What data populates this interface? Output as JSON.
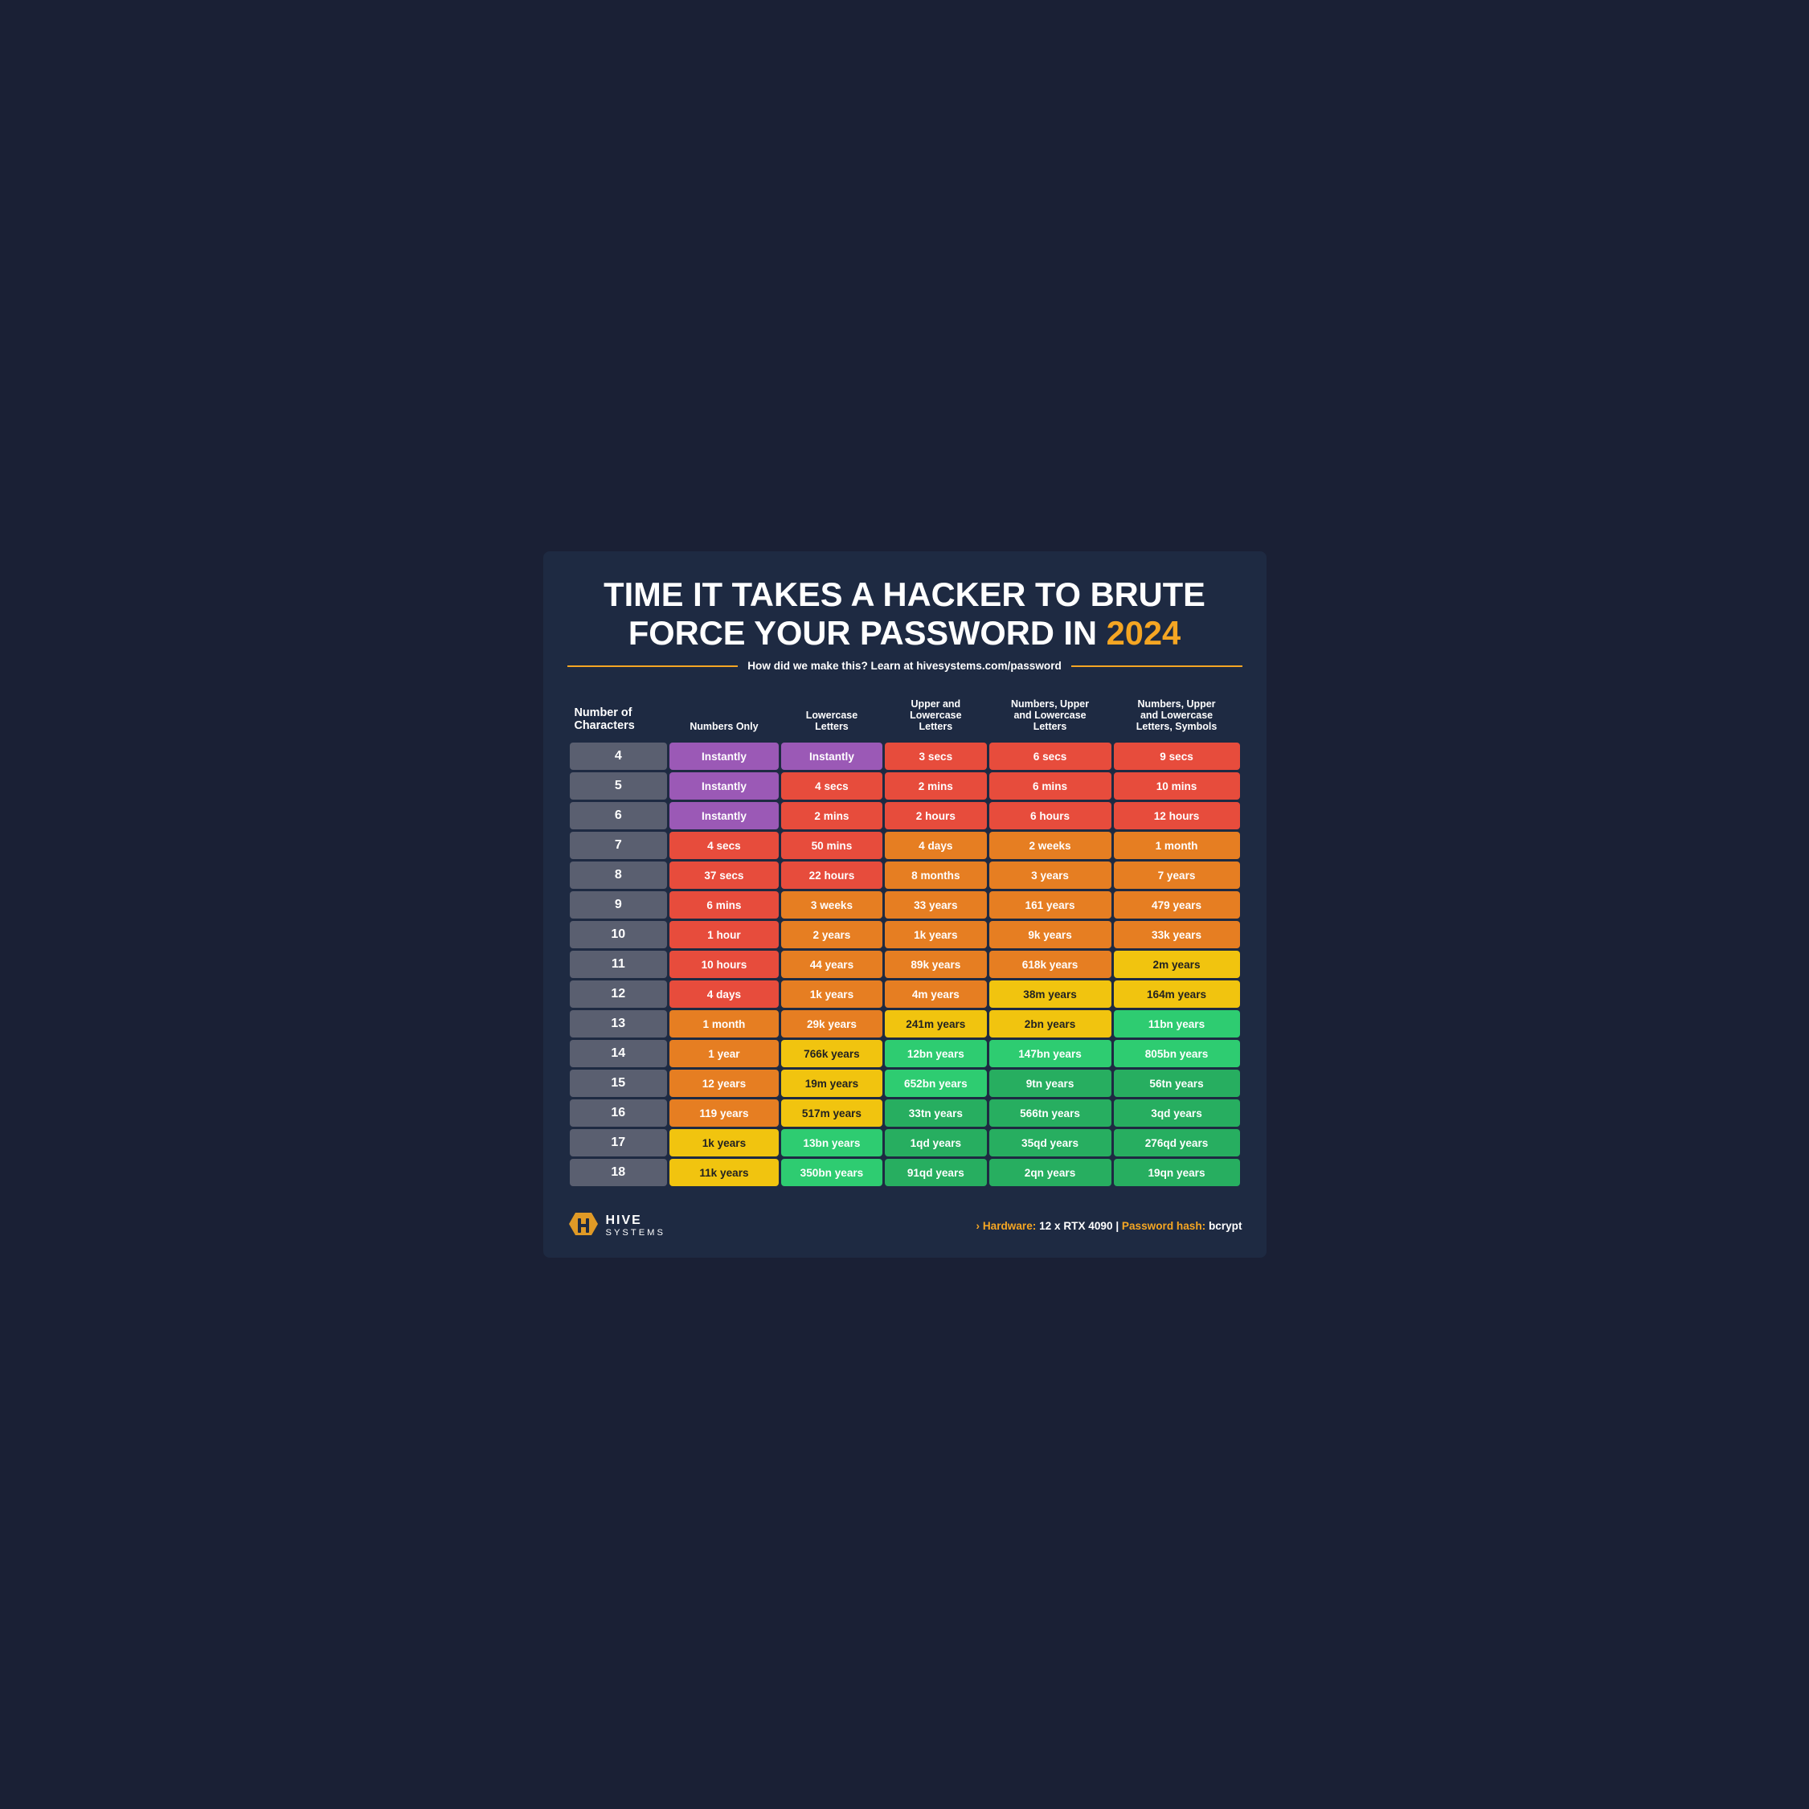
{
  "header": {
    "title_line1": "TIME IT TAKES A HACKER TO BRUTE",
    "title_line2": "FORCE YOUR PASSWORD IN",
    "year": "2024",
    "subtitle": "How did we make this? Learn at hivesystems.com/password"
  },
  "columns": [
    "Number of Characters",
    "Numbers Only",
    "Lowercase Letters",
    "Upper and Lowercase Letters",
    "Numbers, Upper and Lowercase Letters",
    "Numbers, Upper and Lowercase Letters, Symbols"
  ],
  "rows": [
    {
      "chars": "4",
      "c1": "Instantly",
      "c2": "Instantly",
      "c3": "3 secs",
      "c4": "6 secs",
      "c5": "9 secs",
      "cls": [
        "instantly",
        "instantly",
        "red",
        "red",
        "red"
      ]
    },
    {
      "chars": "5",
      "c1": "Instantly",
      "c2": "4 secs",
      "c3": "2 mins",
      "c4": "6 mins",
      "c5": "10 mins",
      "cls": [
        "instantly",
        "red",
        "red",
        "red",
        "red"
      ]
    },
    {
      "chars": "6",
      "c1": "Instantly",
      "c2": "2 mins",
      "c3": "2 hours",
      "c4": "6 hours",
      "c5": "12 hours",
      "cls": [
        "instantly",
        "red",
        "red",
        "red",
        "red"
      ]
    },
    {
      "chars": "7",
      "c1": "4 secs",
      "c2": "50 mins",
      "c3": "4 days",
      "c4": "2 weeks",
      "c5": "1 month",
      "cls": [
        "red",
        "red",
        "orange",
        "orange",
        "orange"
      ]
    },
    {
      "chars": "8",
      "c1": "37 secs",
      "c2": "22 hours",
      "c3": "8 months",
      "c4": "3 years",
      "c5": "7 years",
      "cls": [
        "red",
        "red",
        "orange",
        "orange",
        "orange"
      ]
    },
    {
      "chars": "9",
      "c1": "6 mins",
      "c2": "3 weeks",
      "c3": "33 years",
      "c4": "161 years",
      "c5": "479 years",
      "cls": [
        "red",
        "orange",
        "orange",
        "orange",
        "orange"
      ]
    },
    {
      "chars": "10",
      "c1": "1 hour",
      "c2": "2 years",
      "c3": "1k years",
      "c4": "9k years",
      "c5": "33k years",
      "cls": [
        "red",
        "orange",
        "orange",
        "orange",
        "orange"
      ]
    },
    {
      "chars": "11",
      "c1": "10 hours",
      "c2": "44 years",
      "c3": "89k years",
      "c4": "618k years",
      "c5": "2m years",
      "cls": [
        "red",
        "orange",
        "orange",
        "orange",
        "yellow"
      ]
    },
    {
      "chars": "12",
      "c1": "4 days",
      "c2": "1k years",
      "c3": "4m years",
      "c4": "38m years",
      "c5": "164m years",
      "cls": [
        "red",
        "orange",
        "orange",
        "yellow",
        "yellow"
      ]
    },
    {
      "chars": "13",
      "c1": "1 month",
      "c2": "29k years",
      "c3": "241m years",
      "c4": "2bn years",
      "c5": "11bn years",
      "cls": [
        "orange",
        "orange",
        "yellow",
        "yellow",
        "light-green"
      ]
    },
    {
      "chars": "14",
      "c1": "1 year",
      "c2": "766k years",
      "c3": "12bn years",
      "c4": "147bn years",
      "c5": "805bn years",
      "cls": [
        "orange",
        "yellow",
        "light-green",
        "light-green",
        "light-green"
      ]
    },
    {
      "chars": "15",
      "c1": "12 years",
      "c2": "19m years",
      "c3": "652bn years",
      "c4": "9tn years",
      "c5": "56tn years",
      "cls": [
        "orange",
        "yellow",
        "light-green",
        "green",
        "green"
      ]
    },
    {
      "chars": "16",
      "c1": "119 years",
      "c2": "517m years",
      "c3": "33tn years",
      "c4": "566tn years",
      "c5": "3qd years",
      "cls": [
        "orange",
        "yellow",
        "green",
        "green",
        "green"
      ]
    },
    {
      "chars": "17",
      "c1": "1k years",
      "c2": "13bn years",
      "c3": "1qd years",
      "c4": "35qd years",
      "c5": "276qd years",
      "cls": [
        "yellow",
        "light-green",
        "green",
        "green",
        "green"
      ]
    },
    {
      "chars": "18",
      "c1": "11k years",
      "c2": "350bn years",
      "c3": "91qd years",
      "c4": "2qn years",
      "c5": "19qn years",
      "cls": [
        "yellow",
        "light-green",
        "green",
        "green",
        "green"
      ]
    }
  ],
  "footer": {
    "logo_hive": "HIVE",
    "logo_systems": "SYSTEMS",
    "hardware_label": "Hardware:",
    "hardware_value": "12 x RTX 4090",
    "hash_label": "Password hash:",
    "hash_value": "bcrypt",
    "arrow": "›"
  }
}
